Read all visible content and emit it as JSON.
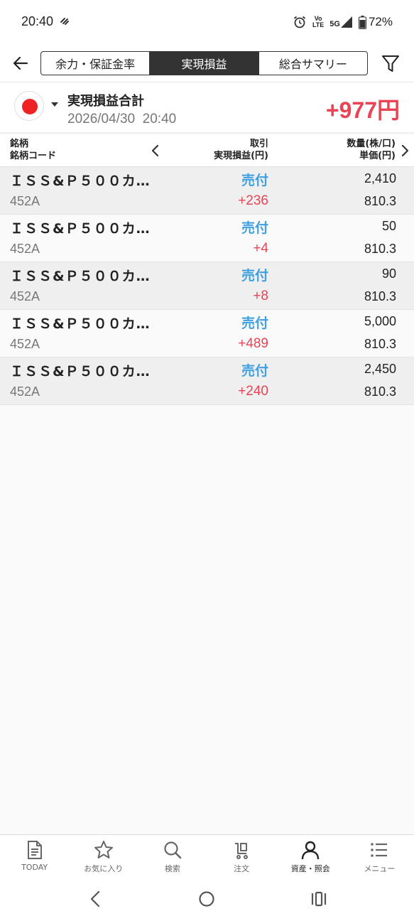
{
  "status_bar": {
    "time": "20:40",
    "network_top": "Vo",
    "network_bottom": "LTE",
    "signal_label": "5G",
    "battery": "72%"
  },
  "header": {
    "tabs": [
      {
        "label": "余力・保証金率",
        "active": false
      },
      {
        "label": "実現損益",
        "active": true
      },
      {
        "label": "総合サマリー",
        "active": false
      }
    ]
  },
  "summary": {
    "title": "実現損益合計",
    "datetime": "2026/04/30  20:40",
    "total": "+977円",
    "account_color": "#ee2222"
  },
  "table": {
    "col1_line1": "銘柄",
    "col1_line2": "銘柄コード",
    "col2_line1": "取引",
    "col2_line2": "実現損益(円)",
    "col3_line1": "数量(株/口)",
    "col3_line2": "単価(円)",
    "rows": [
      {
        "name": "ＩＳＳ&Ｐ５００カ…",
        "code": "452A",
        "type": "売付",
        "pl": "+236",
        "qty": "2,410",
        "price": "810.3"
      },
      {
        "name": "ＩＳＳ&Ｐ５００カ…",
        "code": "452A",
        "type": "売付",
        "pl": "+4",
        "qty": "50",
        "price": "810.3"
      },
      {
        "name": "ＩＳＳ&Ｐ５００カ…",
        "code": "452A",
        "type": "売付",
        "pl": "+8",
        "qty": "90",
        "price": "810.3"
      },
      {
        "name": "ＩＳＳ&Ｐ５００カ…",
        "code": "452A",
        "type": "売付",
        "pl": "+489",
        "qty": "5,000",
        "price": "810.3"
      },
      {
        "name": "ＩＳＳ&Ｐ５００カ…",
        "code": "452A",
        "type": "売付",
        "pl": "+240",
        "qty": "2,450",
        "price": "810.3"
      }
    ]
  },
  "bottom_nav": [
    {
      "label": "TODAY",
      "icon": "today-icon"
    },
    {
      "label": "お気に入り",
      "icon": "star-icon"
    },
    {
      "label": "検索",
      "icon": "search-icon"
    },
    {
      "label": "注文",
      "icon": "cart-icon"
    },
    {
      "label": "資産・照会",
      "icon": "person-icon",
      "active": true
    },
    {
      "label": "メニュー",
      "icon": "menu-icon"
    }
  ],
  "colors": {
    "profit": "#e84455",
    "sell": "#3ea0e0",
    "active_tab_bg": "#333333"
  }
}
